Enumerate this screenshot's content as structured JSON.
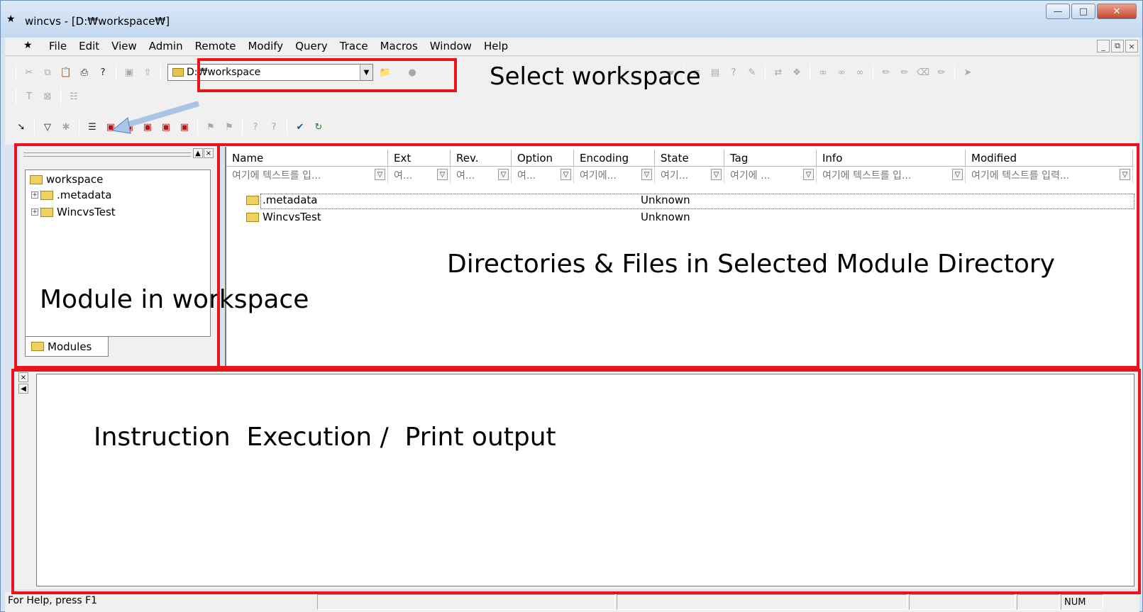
{
  "window": {
    "title": "wincvs - [D:₩workspace₩]",
    "controls": [
      "minimize",
      "maximize",
      "close"
    ]
  },
  "menubar": {
    "items": [
      "File",
      "Edit",
      "View",
      "Admin",
      "Remote",
      "Modify",
      "Query",
      "Trace",
      "Macros",
      "Window",
      "Help"
    ]
  },
  "toolbar": {
    "workspace_path": "D:₩workspace"
  },
  "annotations": {
    "select_workspace": "Select workspace",
    "module_in_workspace": "Module in workspace",
    "directories_files": "Directories & Files in Selected Module Directory",
    "instruction_output": "Instruction  Execution /  Print output"
  },
  "module_tree": {
    "root": "workspace",
    "children": [
      ".metadata",
      "WincvsTest"
    ],
    "tab_label": "Modules"
  },
  "file_list": {
    "columns": [
      "Name",
      "Ext",
      "Rev.",
      "Option",
      "Encoding",
      "State",
      "Tag",
      "Info",
      "Modified"
    ],
    "filter_placeholders": [
      "여기에 텍스트를 입...",
      "여...",
      "여...",
      "여...",
      "여기에...",
      "여기...",
      "여기에 ...",
      "여기에 텍스트를 입...",
      "여기에 텍스트를 입력..."
    ],
    "rows": [
      {
        "name": ".metadata",
        "state": "Unknown"
      },
      {
        "name": "WincvsTest",
        "state": "Unknown"
      }
    ]
  },
  "statusbar": {
    "help_text": "For Help, press F1",
    "num_indicator": "NUM"
  }
}
